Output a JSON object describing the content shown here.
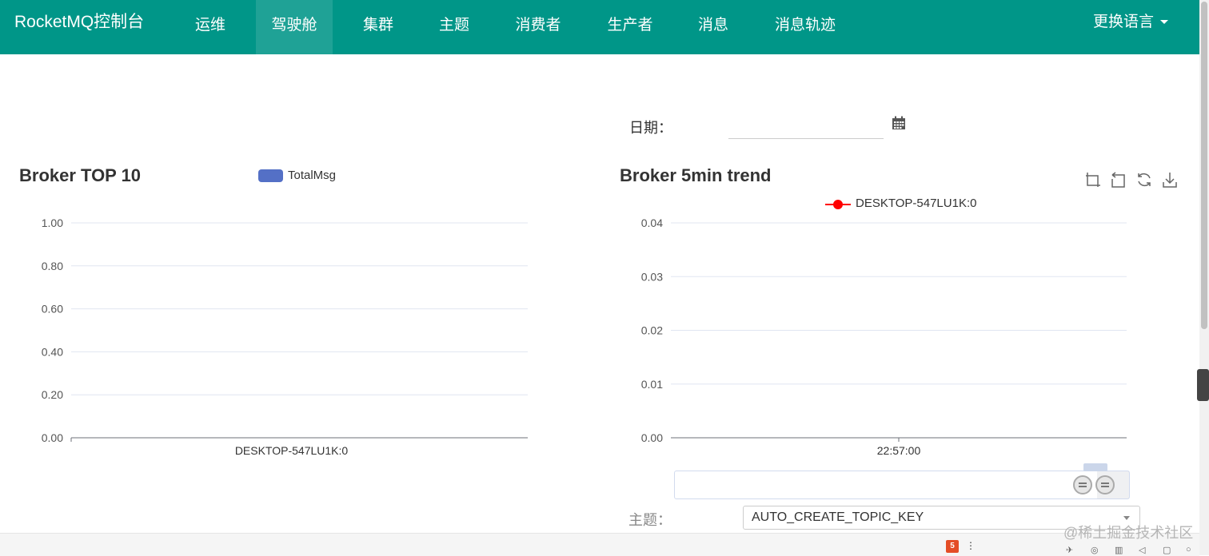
{
  "app": {
    "brand": "RocketMQ控制台"
  },
  "nav": {
    "items": [
      {
        "label": "运维",
        "active": false
      },
      {
        "label": "驾驶舱",
        "active": true
      },
      {
        "label": "集群",
        "active": false
      },
      {
        "label": "主题",
        "active": false
      },
      {
        "label": "消费者",
        "active": false
      },
      {
        "label": "生产者",
        "active": false
      },
      {
        "label": "消息",
        "active": false
      },
      {
        "label": "消息轨迹",
        "active": false
      }
    ],
    "language": "更换语言"
  },
  "date": {
    "label": "日期：",
    "value": ""
  },
  "topic": {
    "label": "主题：",
    "selected": "AUTO_CREATE_TOPIC_KEY"
  },
  "watermark": "@稀土掘金技术社区",
  "colors": {
    "navbar": "#009688",
    "bar_series": "#5470c6",
    "line_series": "#ff0000"
  },
  "chart_data": [
    {
      "type": "bar",
      "title": "Broker TOP 10",
      "categories": [
        "DESKTOP-547LU1K:0"
      ],
      "series": [
        {
          "name": "TotalMsg",
          "values": [
            0
          ]
        }
      ],
      "ylim": [
        0,
        1.0
      ],
      "yticks": [
        "1.00",
        "0.80",
        "0.60",
        "0.40",
        "0.20",
        "0.00"
      ],
      "grid": true,
      "legend": "top-center"
    },
    {
      "type": "line",
      "title": "Broker 5min trend",
      "x": [
        "22:57:00"
      ],
      "series": [
        {
          "name": "DESKTOP-547LU1K:0",
          "values": [
            0
          ]
        }
      ],
      "ylim": [
        0,
        0.04
      ],
      "yticks": [
        "0.04",
        "0.03",
        "0.02",
        "0.01",
        "0.00"
      ],
      "grid": true,
      "legend": "top-center"
    }
  ]
}
